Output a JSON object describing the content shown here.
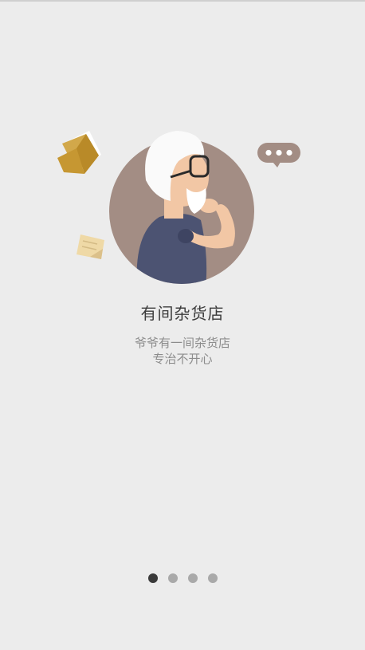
{
  "intro": {
    "title": "有间杂货店",
    "subtitle_lines": [
      "爷爷有一间杂货店",
      "专治不开心"
    ]
  },
  "pager": {
    "page_count": 4,
    "active_index": 0
  },
  "illustration": {
    "subject": "old man thinking",
    "icons": [
      "open-book-icon",
      "sticky-note-icon",
      "speech-bubble-icon"
    ]
  },
  "colors": {
    "background": "#ececec",
    "circle": "#a38d84",
    "shirt": "#4c5372",
    "dot_active": "#3a3a3a",
    "dot_inactive": "#a9a9a9"
  }
}
